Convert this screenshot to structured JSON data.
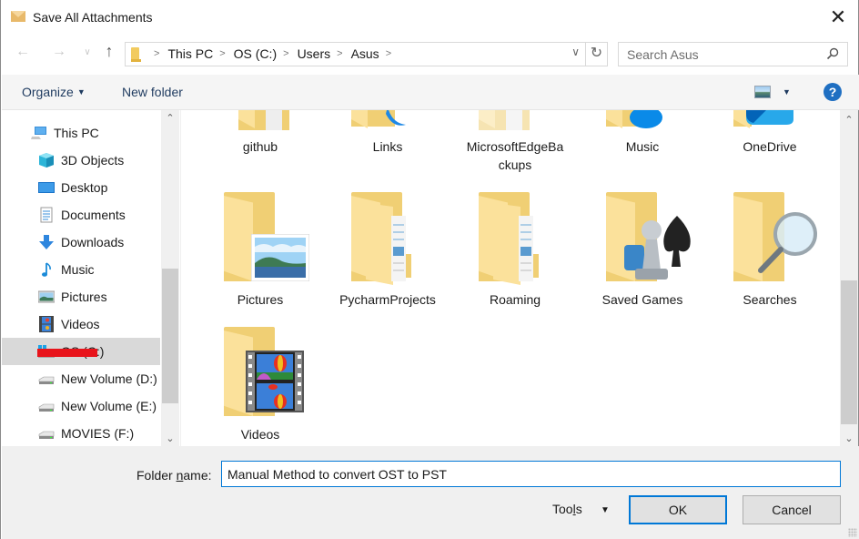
{
  "window": {
    "title": "Save All Attachments",
    "close_label": "✕"
  },
  "nav": {
    "back_glyph": "←",
    "forward_glyph": "→",
    "recent_glyph": "∨",
    "up_glyph": "↑",
    "breadcrumb": [
      "This PC",
      "OS (C:)",
      "Users",
      "Asus"
    ],
    "sep_glyph": ">",
    "dropdown_glyph": "∨",
    "refresh_glyph": "↻"
  },
  "search": {
    "placeholder": "Search Asus"
  },
  "toolbar": {
    "organize_label": "Organize",
    "caret": "▼",
    "new_folder_label": "New folder",
    "view_caret": "▼",
    "help_label": "?"
  },
  "sidebar": {
    "scroll_up": "⌃",
    "scroll_down": "⌄",
    "items": [
      {
        "label": "This PC",
        "icon": "computer-icon"
      },
      {
        "label": "3D Objects",
        "icon": "cube-icon"
      },
      {
        "label": "Desktop",
        "icon": "desktop-icon"
      },
      {
        "label": "Documents",
        "icon": "document-icon"
      },
      {
        "label": "Downloads",
        "icon": "download-icon"
      },
      {
        "label": "Music",
        "icon": "music-note-icon"
      },
      {
        "label": "Pictures",
        "icon": "picture-icon"
      },
      {
        "label": "Videos",
        "icon": "film-icon"
      },
      {
        "label": "OS (C:)",
        "icon": "windows-drive-icon",
        "selected": true,
        "redacted": true
      },
      {
        "label": "New Volume (D:)",
        "icon": "drive-icon"
      },
      {
        "label": "New Volume (E:)",
        "icon": "drive-icon"
      },
      {
        "label": "MOVIES (F:)",
        "icon": "drive-icon"
      }
    ]
  },
  "content": {
    "scroll_up": "⌃",
    "scroll_down": "⌄",
    "folders": [
      {
        "label": "github",
        "overlay": "document"
      },
      {
        "label": "Links",
        "overlay": "link"
      },
      {
        "label": "MicrosoftEdgeBa ckups",
        "line1": "MicrosoftEdgeBa",
        "line2": "ckups",
        "overlay": "document",
        "faded": true
      },
      {
        "label": "Music",
        "overlay": "music"
      },
      {
        "label": "OneDrive",
        "overlay": "cloud"
      },
      {
        "label": "Pictures",
        "overlay": "picture"
      },
      {
        "label": "PycharmProjects",
        "overlay": "document"
      },
      {
        "label": "Roaming",
        "overlay": "document"
      },
      {
        "label": "Saved Games",
        "overlay": "games"
      },
      {
        "label": "Searches",
        "overlay": "magnifier"
      },
      {
        "label": "Videos",
        "overlay": "film"
      }
    ]
  },
  "footer": {
    "folder_name_label_pre": "Folder ",
    "folder_name_label_u": "n",
    "folder_name_label_post": "ame:",
    "folder_name_value": "Manual Method to convert OST to PST",
    "tools_pre": "Too",
    "tools_u": "l",
    "tools_post": "s",
    "tools_caret": "▼",
    "ok_label": "OK",
    "cancel_label": "Cancel"
  }
}
